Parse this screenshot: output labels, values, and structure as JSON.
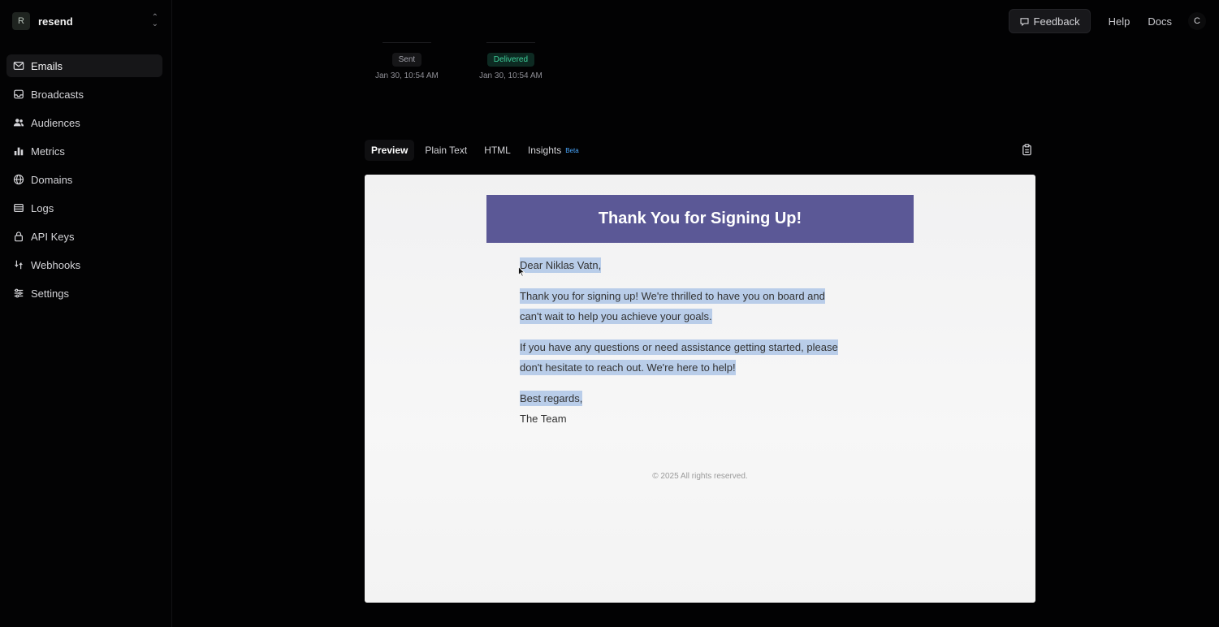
{
  "sidebar": {
    "team_initial": "R",
    "team_name": "resend",
    "items": [
      {
        "label": "Emails",
        "icon": "mail-icon"
      },
      {
        "label": "Broadcasts",
        "icon": "broadcast-icon"
      },
      {
        "label": "Audiences",
        "icon": "users-icon"
      },
      {
        "label": "Metrics",
        "icon": "bar-chart-icon"
      },
      {
        "label": "Domains",
        "icon": "globe-icon"
      },
      {
        "label": "Logs",
        "icon": "logs-icon"
      },
      {
        "label": "API Keys",
        "icon": "lock-icon"
      },
      {
        "label": "Webhooks",
        "icon": "webhook-icon"
      },
      {
        "label": "Settings",
        "icon": "sliders-icon"
      }
    ],
    "active_item": "Emails"
  },
  "header": {
    "feedback_label": "Feedback",
    "help_label": "Help",
    "docs_label": "Docs",
    "user_initial": "C"
  },
  "timeline": [
    {
      "status": "Sent",
      "time": "Jan 30, 10:54 AM"
    },
    {
      "status": "Delivered",
      "time": "Jan 30, 10:54 AM"
    }
  ],
  "tabs": {
    "preview": "Preview",
    "plain_text": "Plain Text",
    "html": "HTML",
    "insights": "Insights",
    "insights_badge": "Beta",
    "active": "Preview"
  },
  "email": {
    "header_title": "Thank You for Signing Up!",
    "header_color": "#5b5896",
    "greeting": "Dear Niklas Vatn,",
    "para1_line1": "Thank you for signing up! We're thrilled to have you on board and",
    "para1_line2": "can't wait to help you achieve your goals.",
    "para2_line1": "If you have any questions or need assistance getting started, please",
    "para2_line2": "don't hesitate to reach out. We're here to help!",
    "closing": "Best regards,",
    "signature": "The Team",
    "footer": "© 2025 All rights reserved."
  },
  "colors": {
    "background": "#020203",
    "delivered_badge_text": "#3ecf9a",
    "beta_badge": "#4aa8ff",
    "selection_highlight": "#b9cde9"
  }
}
